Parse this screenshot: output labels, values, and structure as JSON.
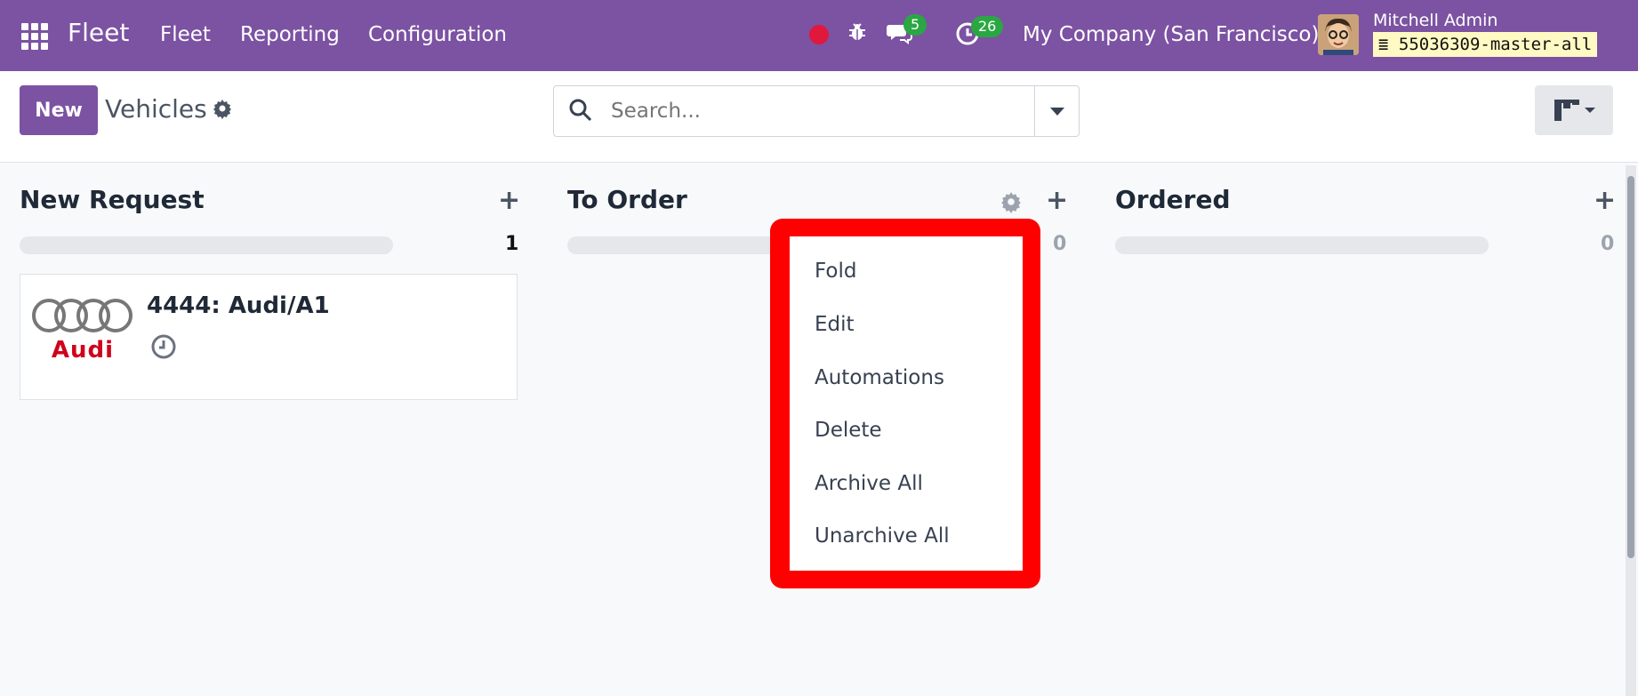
{
  "navbar": {
    "brand": "Fleet",
    "menu": [
      "Fleet",
      "Reporting",
      "Configuration"
    ],
    "chat_count": "5",
    "activity_count": "26",
    "company": "My Company (San Francisco)",
    "user_name": "Mitchell Admin",
    "database": "55036309-master-all",
    "colors": {
      "bar": "#7c52a2",
      "badge": "#2aa742",
      "record": "#e0183c"
    }
  },
  "control": {
    "new_label": "New",
    "title": "Vehicles",
    "search_placeholder": "Search..."
  },
  "columns": [
    {
      "title": "New Request",
      "count": "1"
    },
    {
      "title": "To Order",
      "count": "0"
    },
    {
      "title": "Ordered",
      "count": "0"
    }
  ],
  "card": {
    "title": "4444: Audi/A1",
    "logo_text": "Audi"
  },
  "dropdown": {
    "items": [
      "Fold",
      "Edit",
      "Automations",
      "Delete",
      "Archive All",
      "Unarchive All"
    ],
    "highlight_color": "#ff0000"
  }
}
